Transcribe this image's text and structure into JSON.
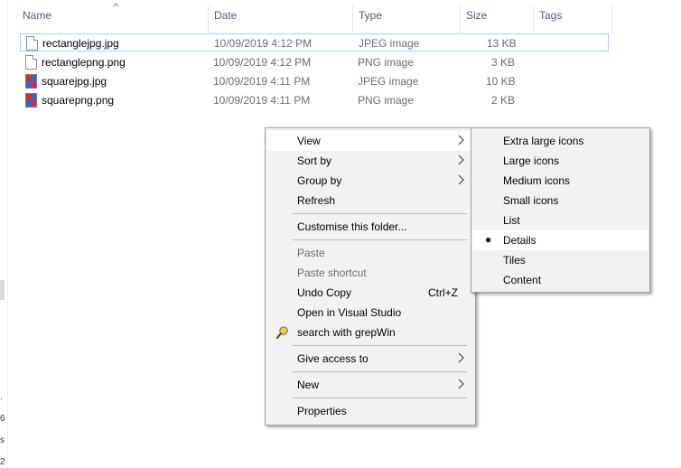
{
  "columns": {
    "name": "Name",
    "date": "Date",
    "type": "Type",
    "size": "Size",
    "tags": "Tags"
  },
  "files": [
    {
      "name": "rectanglejpg.jpg",
      "date": "10/09/2019 4:12 PM",
      "type": "JPEG image",
      "size": "13 KB",
      "icon": "blank-file-icon"
    },
    {
      "name": "rectanglepng.png",
      "date": "10/09/2019 4:12 PM",
      "type": "PNG image",
      "size": "3 KB",
      "icon": "blank-file-icon"
    },
    {
      "name": "squarejpg.jpg",
      "date": "10/09/2019 4:11 PM",
      "type": "JPEG image",
      "size": "10 KB",
      "icon": "image-thumbnail-icon"
    },
    {
      "name": "squarepng.png",
      "date": "10/09/2019 4:11 PM",
      "type": "PNG image",
      "size": "2 KB",
      "icon": "image-thumbnail-icon"
    }
  ],
  "context_menu": {
    "view": "View",
    "sort_by": "Sort by",
    "group_by": "Group by",
    "refresh": "Refresh",
    "customise": "Customise this folder...",
    "paste": "Paste",
    "paste_shortcut": "Paste shortcut",
    "undo_copy": "Undo Copy",
    "undo_copy_shortcut": "Ctrl+Z",
    "open_vs": "Open in Visual Studio",
    "grepwin": "search with grepWin",
    "give_access": "Give access to",
    "new": "New",
    "properties": "Properties"
  },
  "view_submenu": {
    "extra_large": "Extra large icons",
    "large": "Large icons",
    "medium": "Medium icons",
    "small": "Small icons",
    "list": "List",
    "details": "Details",
    "tiles": "Tiles",
    "content": "Content",
    "selected_marker": "●"
  },
  "left_edge_chars": [
    ".",
    "6",
    "s",
    "2"
  ],
  "colors": {
    "menu_bg": "#f2f2f2",
    "highlight": "#ffffff",
    "focus_border": "#99d1ff",
    "header_text": "#4c607a"
  }
}
